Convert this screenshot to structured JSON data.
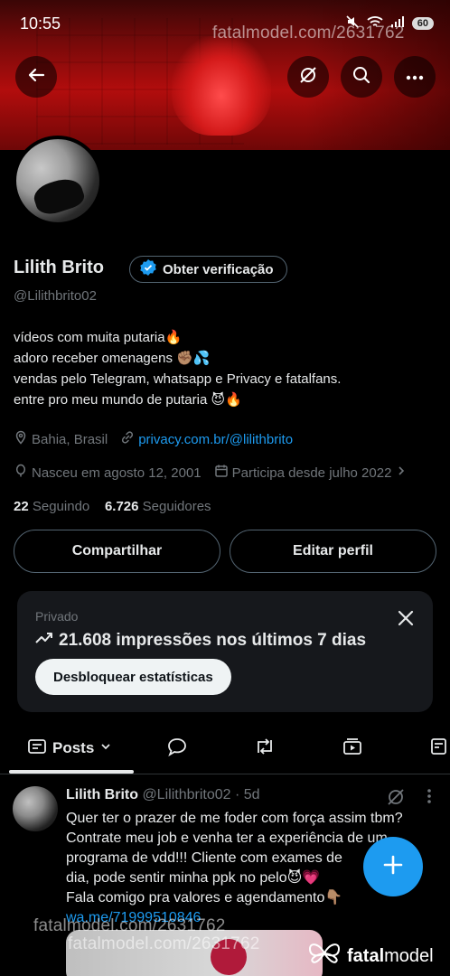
{
  "status_bar": {
    "time": "10:55",
    "battery": "60"
  },
  "watermark": {
    "text": "fatalmodel.com/2631762",
    "brand_name_bold": "fatal",
    "brand_name_rest": "model"
  },
  "profile": {
    "name": "Lilith Brito",
    "verify_label": "Obter verificação",
    "handle": "@Lilithbrito02",
    "bio": [
      "vídeos com muita putaria🔥",
      "adoro receber omenagens ✊🏽💦",
      "vendas pelo Telegram, whatsapp e Privacy e fatalfans.",
      "entre pro meu mundo de putaria 😈🔥"
    ],
    "location": "Bahia, Brasil",
    "website": "privacy.com.br/@lilithbrito",
    "birth": "Nasceu em agosto 12, 2001",
    "joined": "Participa desde julho 2022",
    "following_count": "22",
    "following_label": "Seguindo",
    "followers_count": "6.726",
    "followers_label": "Seguidores",
    "share_label": "Compartilhar",
    "edit_label": "Editar perfil"
  },
  "stats_card": {
    "label": "Privado",
    "impressions": "21.608 impressões nos últimos 7 dias",
    "unlock_label": "Desbloquear estatísticas"
  },
  "tabs": {
    "posts_label": "Posts"
  },
  "post": {
    "name": "Lilith Brito",
    "meta": "@Lilithbrito02 · 5d",
    "lines": [
      "Quer ter o prazer de me foder com força assim tbm?",
      "Contrate meu job e venha ter a experiência de um",
      "programa de vdd!!! Cliente com exames de",
      "dia, pode sentir minha ppk no pelo😈💗",
      "Fala comigo pra valores e agendamento👇🏽"
    ],
    "link": "wa.me/71999510846"
  },
  "colors": {
    "accent": "#1d9bf0",
    "background": "#000000",
    "muted": "#71767b"
  }
}
